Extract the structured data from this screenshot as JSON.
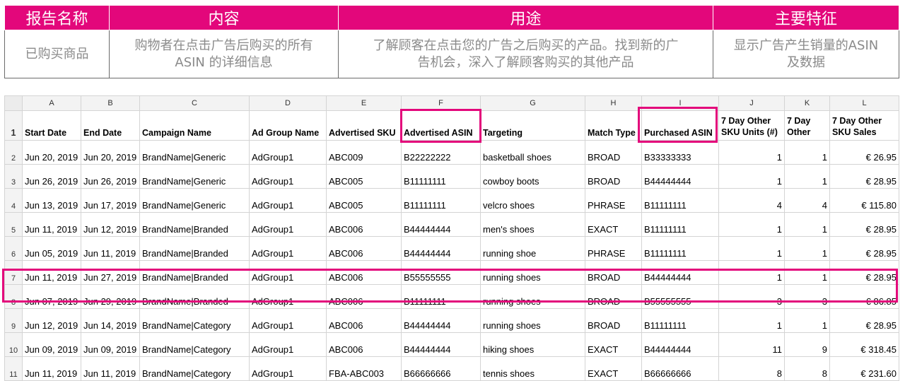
{
  "info_table": {
    "headers": [
      "报告名称",
      "内容",
      "用途",
      "主要特征"
    ],
    "row": [
      [
        "已购买商品"
      ],
      [
        "购物者在点击广告后购买的所有",
        "ASIN 的详细信息"
      ],
      [
        "了解顾客在点击您的广告之后购买的产品。找到新的广",
        "告机会，深入了解顾客购买的其他产品"
      ],
      [
        "显示广告产生销量的ASIN",
        "及数据"
      ]
    ]
  },
  "sheet": {
    "col_letters": [
      "A",
      "B",
      "C",
      "D",
      "E",
      "F",
      "G",
      "H",
      "I",
      "J",
      "K",
      "L"
    ],
    "header_row_number": "1",
    "headers": [
      [
        "Start Date"
      ],
      [
        "End Date"
      ],
      [
        "Campaign Name"
      ],
      [
        "Ad Group Name"
      ],
      [
        "Advertised SKU"
      ],
      [
        "Advertised ASIN"
      ],
      [
        "Targeting"
      ],
      [
        "Match Type"
      ],
      [
        "Purchased ASIN"
      ],
      [
        "7 Day Other",
        "SKU Units (#)"
      ],
      [
        "7 Day",
        "Other"
      ],
      [
        "7 Day Other",
        "SKU Sales"
      ]
    ],
    "rows": [
      [
        "2",
        "Jun 20, 2019",
        "Jun 20, 2019",
        "BrandName|Generic",
        "AdGroup1",
        "ABC009",
        "B22222222",
        "basketball shoes",
        "BROAD",
        "B33333333",
        "1",
        "1",
        "€ 26.95"
      ],
      [
        "3",
        "Jun 26, 2019",
        "Jun 26, 2019",
        "BrandName|Generic",
        "AdGroup1",
        "ABC005",
        "B11111111",
        "cowboy boots",
        "BROAD",
        "B44444444",
        "1",
        "1",
        "€ 28.95"
      ],
      [
        "4",
        "Jun 13, 2019",
        "Jun 17, 2019",
        "BrandName|Generic",
        "AdGroup1",
        "ABC005",
        "B11111111",
        "velcro shoes",
        "PHRASE",
        "B11111111",
        "4",
        "4",
        "€ 115.80"
      ],
      [
        "5",
        "Jun 11, 2019",
        "Jun 12, 2019",
        "BrandName|Branded",
        "AdGroup1",
        "ABC006",
        "B44444444",
        "men's shoes",
        "EXACT",
        "B11111111",
        "1",
        "1",
        "€ 28.95"
      ],
      [
        "6",
        "Jun 05, 2019",
        "Jun 11, 2019",
        "BrandName|Branded",
        "AdGroup1",
        "ABC006",
        "B44444444",
        "running shoe",
        "PHRASE",
        "B11111111",
        "1",
        "1",
        "€ 28.95"
      ],
      [
        "7",
        "Jun 11, 2019",
        "Jun 27, 2019",
        "BrandName|Branded",
        "AdGroup1",
        "ABC006",
        "B55555555",
        "running shoes",
        "BROAD",
        "B44444444",
        "1",
        "1",
        "€ 28.95"
      ],
      [
        "8",
        "Jun 07, 2019",
        "Jun 29, 2019",
        "BrandName|Branded",
        "AdGroup1",
        "ABC006",
        "B11111111",
        "running shoes",
        "BROAD",
        "B55555555",
        "3",
        "3",
        "€ 86.85"
      ],
      [
        "9",
        "Jun 12, 2019",
        "Jun 14, 2019",
        "BrandName|Category",
        "AdGroup1",
        "ABC006",
        "B44444444",
        "running shoes",
        "BROAD",
        "B11111111",
        "1",
        "1",
        "€ 28.95"
      ],
      [
        "10",
        "Jun 09, 2019",
        "Jun 09, 2019",
        "BrandName|Category",
        "AdGroup1",
        "ABC006",
        "B44444444",
        "hiking shoes",
        "EXACT",
        "B44444444",
        "11",
        "9",
        "€ 318.45"
      ],
      [
        "11",
        "Jun 11, 2019",
        "Jun 11, 2019",
        "BrandName|Category",
        "AdGroup1",
        "FBA-ABC003",
        "B66666666",
        "tennis shoes",
        "EXACT",
        "B66666666",
        "8",
        "8",
        "€ 231.60"
      ]
    ]
  },
  "colors": {
    "accent": "#e3077b",
    "info_text": "#8a8a8a"
  }
}
